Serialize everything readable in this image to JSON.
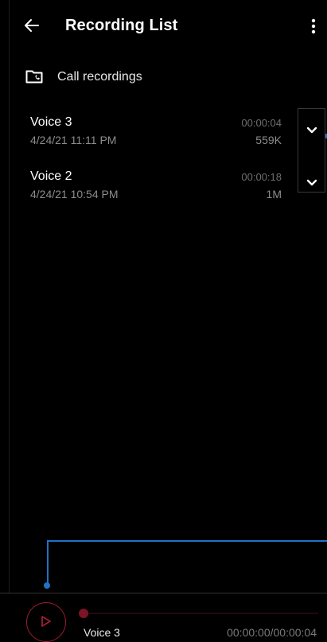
{
  "appbar": {
    "title": "Recording List",
    "back_icon": "arrow-left-icon",
    "menu_icon": "more-vertical-icon"
  },
  "call_recordings": {
    "label": "Call recordings",
    "icon": "folder-call-icon"
  },
  "recordings": [
    {
      "name": "Voice 3",
      "date": "4/24/21 11:11 PM",
      "duration": "00:00:04",
      "size": "559K"
    },
    {
      "name": "Voice 2",
      "date": "4/24/21 10:54 PM",
      "duration": "00:00:18",
      "size": "1M"
    }
  ],
  "player": {
    "name": "Voice 3",
    "time": "00:00:00/00:00:04",
    "progress": 0,
    "play_icon": "play-icon"
  },
  "colors": {
    "background": "#000000",
    "accent_red": "#9b1c31",
    "waveform_blue": "#1f73c7",
    "secondary_text": "#8c8c8c"
  }
}
